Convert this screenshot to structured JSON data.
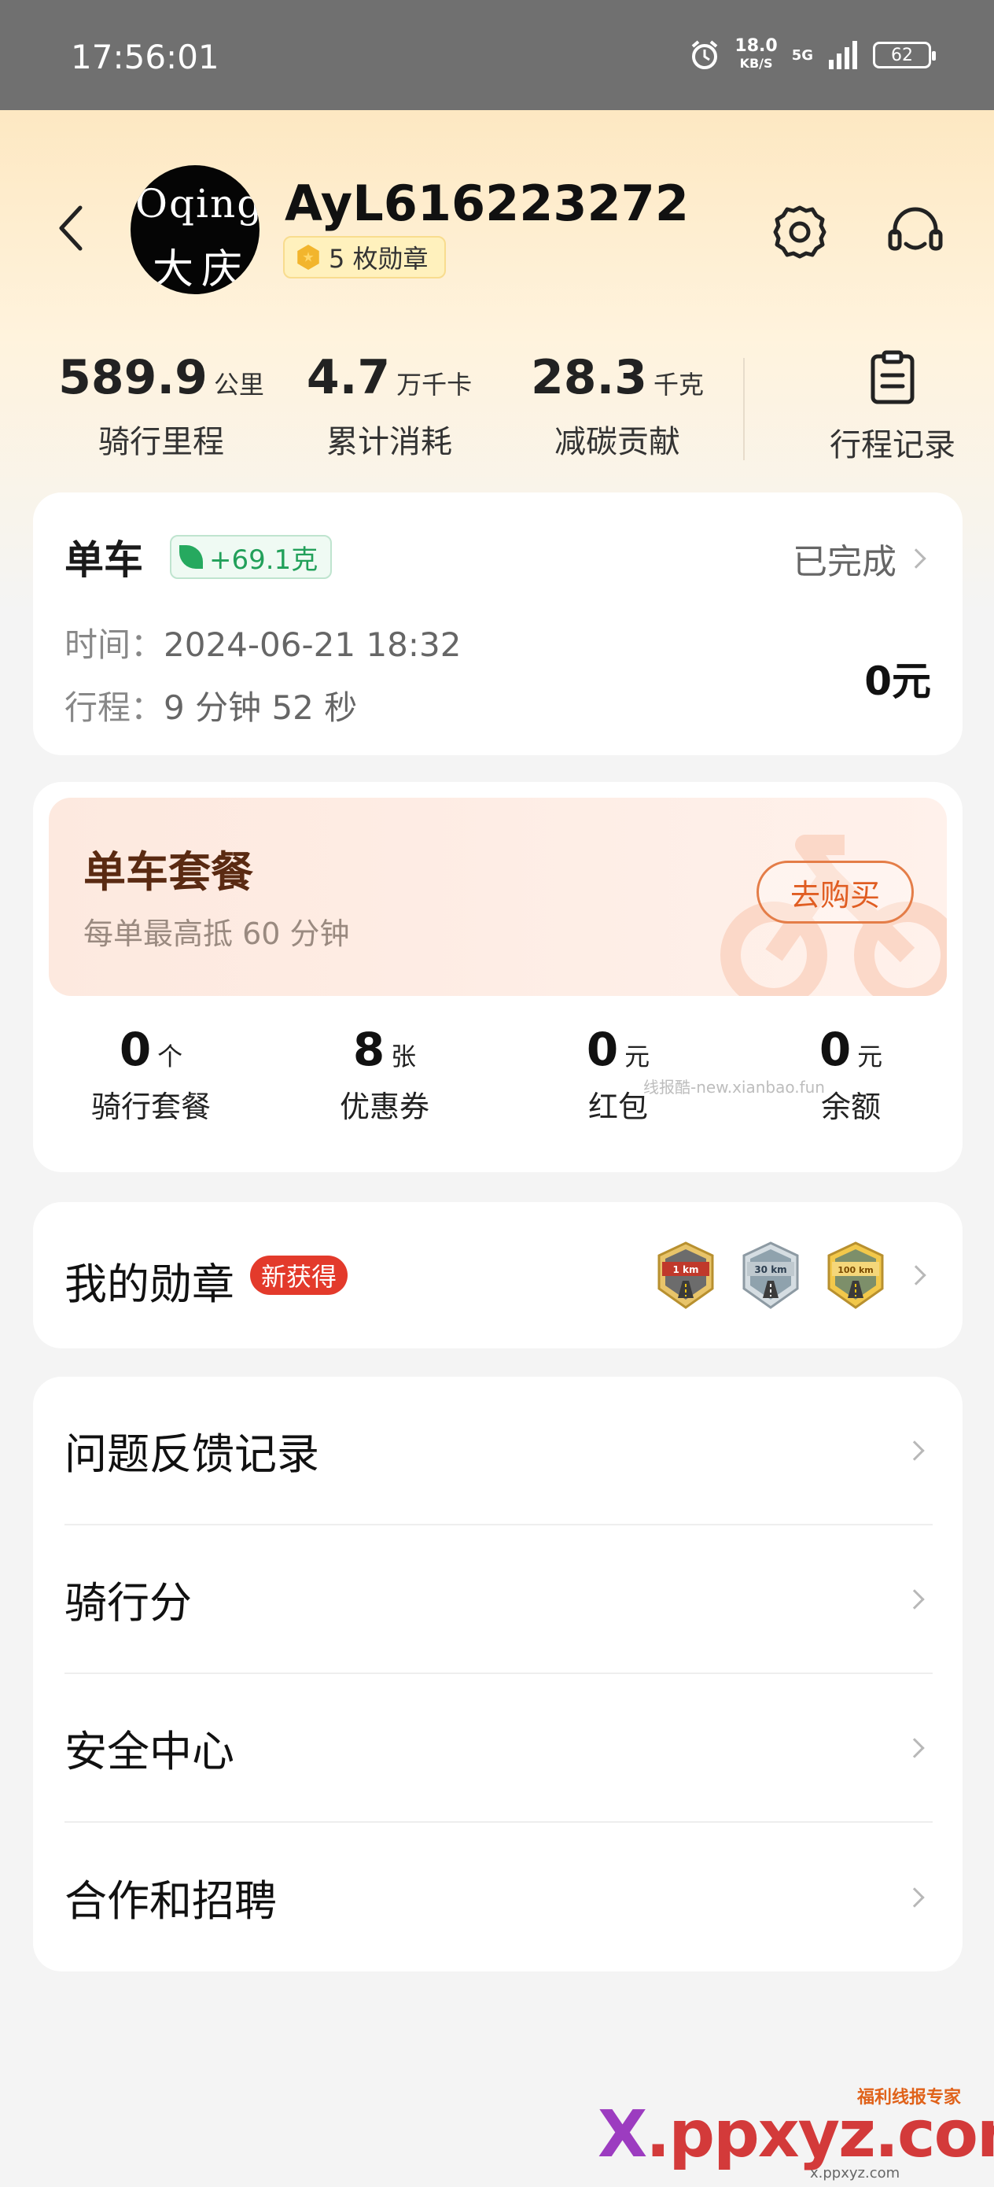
{
  "status_bar": {
    "time": "17:56:01",
    "speed_value": "18.0",
    "speed_unit": "KB/S",
    "network": "5G",
    "battery": "62"
  },
  "profile": {
    "username": "AyL616223272",
    "medal_count_text": "5 枚勋章",
    "avatar_text_line1": "Oqing",
    "avatar_text_line2": "大庆"
  },
  "stats": [
    {
      "value": "589.9",
      "unit": "公里",
      "label": "骑行里程"
    },
    {
      "value": "4.7",
      "unit": "万千卡",
      "label": "累计消耗"
    },
    {
      "value": "28.3",
      "unit": "千克",
      "label": "减碳贡献"
    }
  ],
  "trip_log": {
    "label": "行程记录",
    "icon": "clipboard-icon"
  },
  "ride": {
    "title": "单车",
    "carbon": "+69.1克",
    "status": "已完成",
    "time_label": "时间：",
    "time_value": "2024-06-21 18:32",
    "duration_label": "行程：",
    "duration_value": "9 分钟 52 秒",
    "fee": "0元"
  },
  "package": {
    "title": "单车套餐",
    "subtitle": "每单最高抵 60 分钟",
    "buy_label": "去购买",
    "items": [
      {
        "value": "0",
        "unit": "个",
        "label": "骑行套餐"
      },
      {
        "value": "8",
        "unit": "张",
        "label": "优惠券"
      },
      {
        "value": "0",
        "unit": "元",
        "label": "红包"
      },
      {
        "value": "0",
        "unit": "元",
        "label": "余额"
      }
    ],
    "watermark": "线报酷-new.xianbao.fun"
  },
  "medals": {
    "title": "我的勋章",
    "new_badge": "新获得",
    "badges": [
      {
        "label": "1 km",
        "color": "#c0392b"
      },
      {
        "label": "30 km",
        "color": "#7f8c8d"
      },
      {
        "label": "100 km",
        "color": "#d4a017"
      }
    ]
  },
  "menu": [
    {
      "label": "问题反馈记录"
    },
    {
      "label": "骑行分"
    },
    {
      "label": "安全中心"
    },
    {
      "label": "合作和招聘"
    }
  ],
  "footer_logo": {
    "tagline": "福利线报专家",
    "brand_x": "X",
    "brand_rest": ".ppxyz.com",
    "url": "x.ppxyz.com"
  },
  "colors": {
    "accent_orange": "#e05d22",
    "green": "#22a05a",
    "new_badge_red": "#e33a2b"
  }
}
